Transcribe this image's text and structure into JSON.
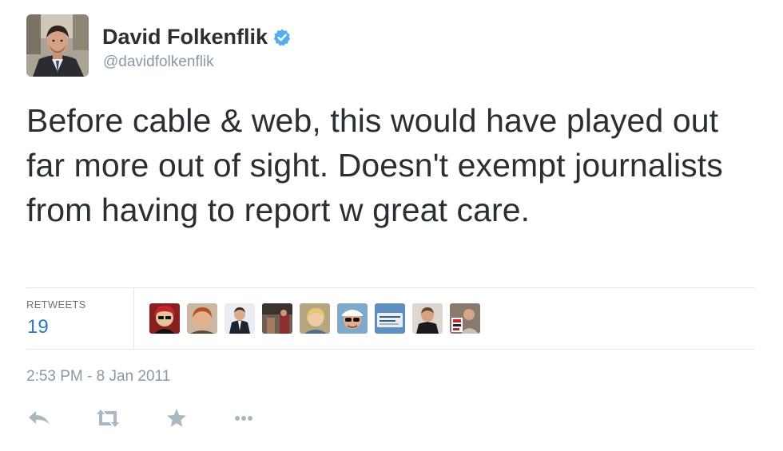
{
  "tweet": {
    "display_name": "David Folkenflik",
    "screen_name": "@davidfolkenflik",
    "verified": true,
    "verified_icon": "verified-badge-icon",
    "text": "Before cable & web, this would have played out far more out of sight. Doesn't exempt journalists from having to report w great care.",
    "timestamp": "2:53 PM - 8 Jan 2011"
  },
  "stats": {
    "retweets_label": "RETWEETS",
    "retweets_count": "19"
  },
  "retweeter_avatars": [
    "retweeter-avatar-1",
    "retweeter-avatar-2",
    "retweeter-avatar-3",
    "retweeter-avatar-4",
    "retweeter-avatar-5",
    "retweeter-avatar-6",
    "retweeter-avatar-7",
    "retweeter-avatar-8",
    "retweeter-avatar-9"
  ],
  "actions": [
    {
      "name": "reply-icon"
    },
    {
      "name": "retweet-icon"
    },
    {
      "name": "favorite-icon"
    },
    {
      "name": "more-icon"
    }
  ],
  "colors": {
    "link_blue": "#2b7bb9",
    "verified_blue": "#55acee",
    "muted_gray": "#8899a6",
    "icon_gray": "#aab8c2",
    "text_dark": "#292f33"
  }
}
